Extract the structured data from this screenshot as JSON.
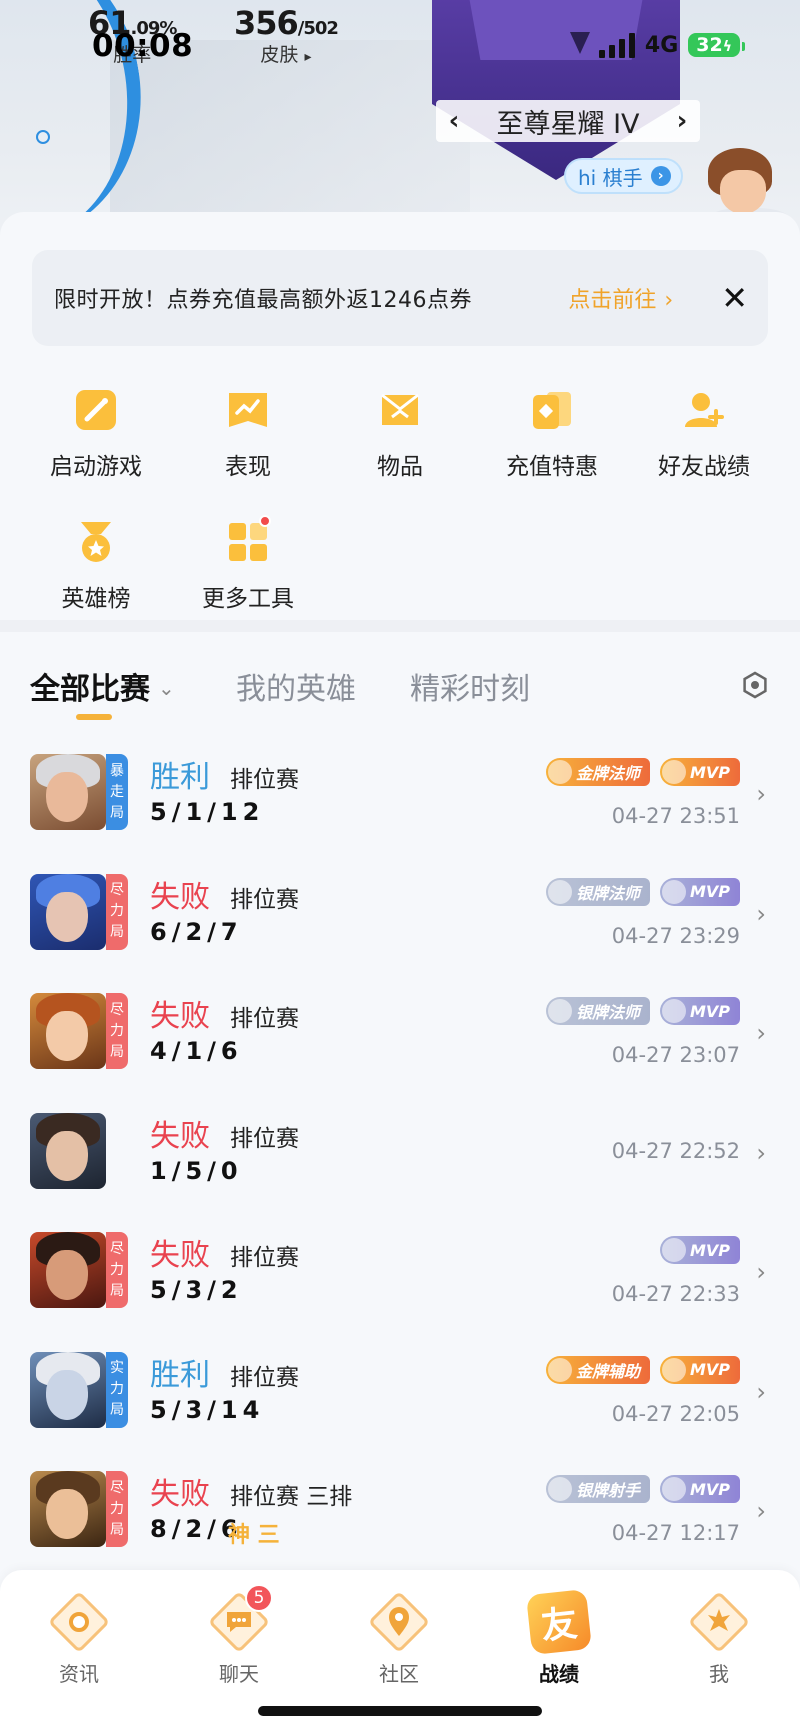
{
  "status_bar": {
    "time": "00:08",
    "network": "4G",
    "battery": "32"
  },
  "header": {
    "win_rate": {
      "value": "61",
      "unit": ".09%",
      "label": "胜率"
    },
    "skins": {
      "value": "356",
      "total": "/502",
      "label": "皮肤",
      "arrow": "▸"
    },
    "rank": {
      "name": "至尊星耀 IV",
      "prev": "‹",
      "next": "›",
      "emblem_tier": "IV"
    },
    "greeting": {
      "text": "hi 棋手",
      "go": "›"
    }
  },
  "promo": {
    "text": "限时开放！点券充值最高额外返1246点券",
    "link": "点击前往",
    "link_chevron": "›",
    "close": "✕"
  },
  "tools": [
    {
      "label": "启动游戏",
      "icon": "game-start-icon"
    },
    {
      "label": "表现",
      "icon": "performance-chart-icon"
    },
    {
      "label": "物品",
      "icon": "items-icon"
    },
    {
      "label": "充值特惠",
      "icon": "recharge-icon"
    },
    {
      "label": "好友战绩",
      "icon": "friend-record-icon"
    },
    {
      "label": "英雄榜",
      "icon": "hero-ranking-icon"
    },
    {
      "label": "更多工具",
      "icon": "more-tools-icon"
    }
  ],
  "tabs": {
    "all": "全部比赛",
    "all_caret": "⌄",
    "heroes": "我的英雄",
    "highlights": "精彩时刻"
  },
  "matches": [
    {
      "result": "胜利",
      "outcome": "win",
      "type": "排位赛",
      "kda": "5/1/12",
      "mode": [
        "暴",
        "走",
        "局"
      ],
      "mode_color": "#3b8ee2",
      "badges": [
        {
          "text": "金牌法师",
          "style": "gold"
        },
        {
          "text": "MVP",
          "style": "mvp-gold"
        }
      ],
      "time": "04-27 23:51",
      "extra": ""
    },
    {
      "result": "失败",
      "outcome": "lose",
      "type": "排位赛",
      "kda": "6/2/7",
      "mode": [
        "尽",
        "力",
        "局"
      ],
      "mode_color": "#ef6b6b",
      "badges": [
        {
          "text": "银牌法师",
          "style": "silver"
        },
        {
          "text": "MVP",
          "style": "mvp-silver"
        }
      ],
      "time": "04-27 23:29",
      "extra": ""
    },
    {
      "result": "失败",
      "outcome": "lose",
      "type": "排位赛",
      "kda": "4/1/6",
      "mode": [
        "尽",
        "力",
        "局"
      ],
      "mode_color": "#ef6b6b",
      "badges": [
        {
          "text": "银牌法师",
          "style": "silver"
        },
        {
          "text": "MVP",
          "style": "mvp-silver"
        }
      ],
      "time": "04-27 23:07",
      "extra": ""
    },
    {
      "result": "失败",
      "outcome": "lose",
      "type": "排位赛",
      "kda": "1/5/0",
      "mode": [],
      "mode_color": "",
      "badges": [],
      "time": "04-27 22:52",
      "extra": ""
    },
    {
      "result": "失败",
      "outcome": "lose",
      "type": "排位赛",
      "kda": "5/3/2",
      "mode": [
        "尽",
        "力",
        "局"
      ],
      "mode_color": "#ef6b6b",
      "badges": [
        {
          "text": "MVP",
          "style": "mvp-silver"
        }
      ],
      "time": "04-27 22:33",
      "extra": ""
    },
    {
      "result": "胜利",
      "outcome": "win",
      "type": "排位赛",
      "kda": "5/3/14",
      "mode": [
        "实",
        "力",
        "局"
      ],
      "mode_color": "#3b8ee2",
      "badges": [
        {
          "text": "金牌辅助",
          "style": "gold"
        },
        {
          "text": "MVP",
          "style": "mvp-gold"
        }
      ],
      "time": "04-27 22:05",
      "extra": ""
    },
    {
      "result": "失败",
      "outcome": "lose",
      "type": "排位赛 三排",
      "kda": "8/2/6",
      "mode": [
        "尽",
        "力",
        "局"
      ],
      "mode_color": "#ef6b6b",
      "badges": [
        {
          "text": "银牌射手",
          "style": "silver"
        },
        {
          "text": "MVP",
          "style": "mvp-silver"
        }
      ],
      "time": "04-27 12:17",
      "extra": "神 三"
    }
  ],
  "bottom_nav": [
    {
      "label": "资讯",
      "icon": "news-icon",
      "badge": ""
    },
    {
      "label": "聊天",
      "icon": "chat-icon",
      "badge": "5"
    },
    {
      "label": "社区",
      "icon": "community-icon",
      "badge": ""
    },
    {
      "label": "战绩",
      "icon": "you-icon",
      "badge": "",
      "glyph": "友"
    },
    {
      "label": "我",
      "icon": "profile-icon",
      "badge": ""
    }
  ],
  "colors": {
    "accent": "#f5b23a",
    "win": "#3b9ad9",
    "lose": "#e9434f",
    "promo_link": "#f0a32a"
  }
}
